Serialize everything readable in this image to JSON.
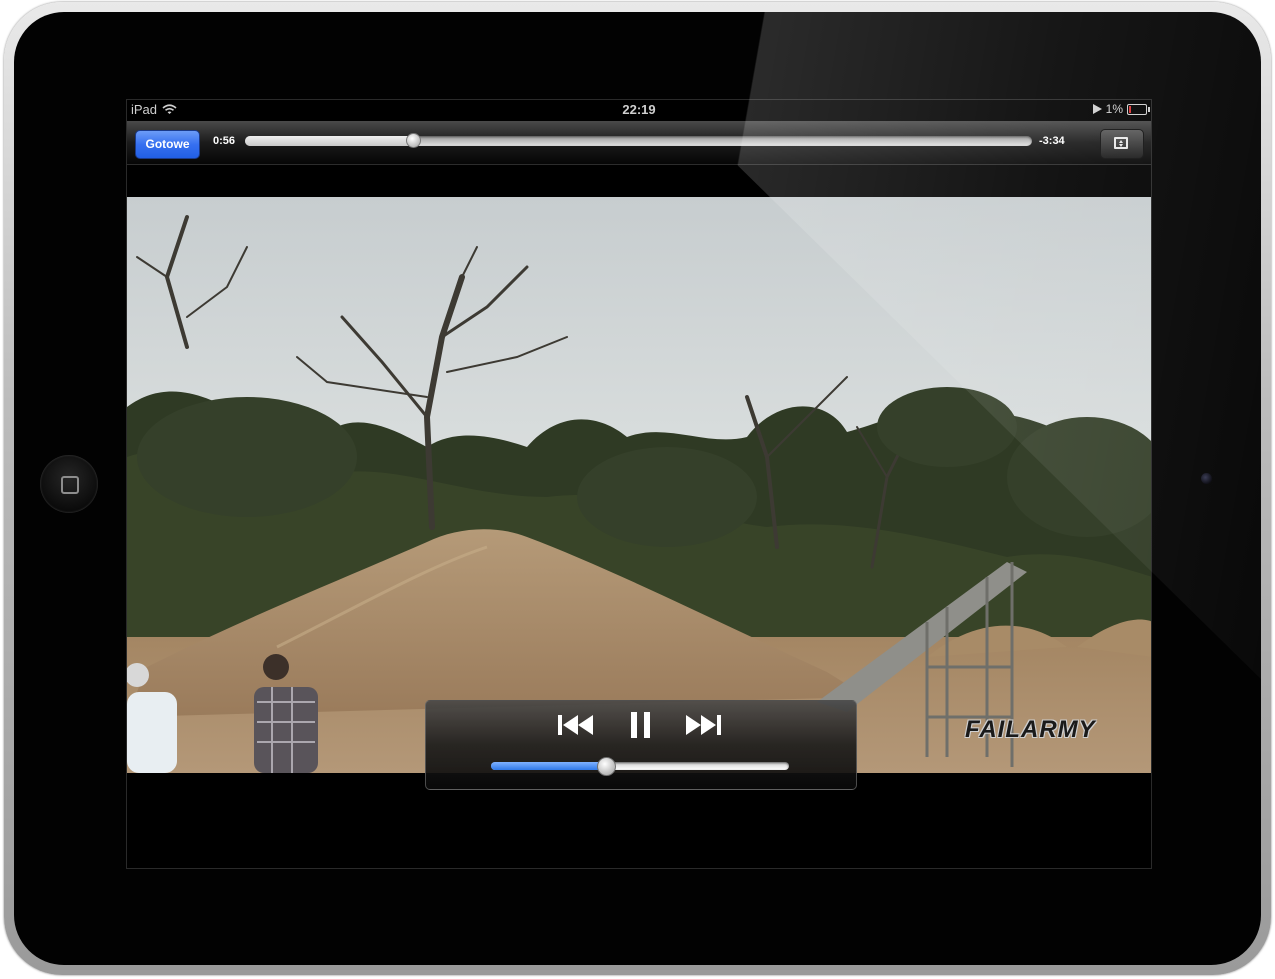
{
  "status_bar": {
    "device": "iPad",
    "time": "22:19",
    "battery": "1%"
  },
  "player": {
    "done_label": "Gotowe",
    "time_elapsed": "0:56",
    "time_remaining": "-3:34",
    "progress": 0.214,
    "volume": 0.385
  },
  "video": {
    "watermark": "FAILARMY"
  },
  "icons": {
    "wifi": "wifi-icon",
    "play_indicator": "play-indicator-icon",
    "battery": "battery-icon",
    "aspect": "aspect-ratio-icon",
    "previous": "skip-previous-icon",
    "pause": "pause-icon",
    "next": "skip-next-icon",
    "home": "home-button-icon"
  },
  "colors": {
    "done_button": "#3670f0",
    "volume_fill": "#2f78e8"
  }
}
